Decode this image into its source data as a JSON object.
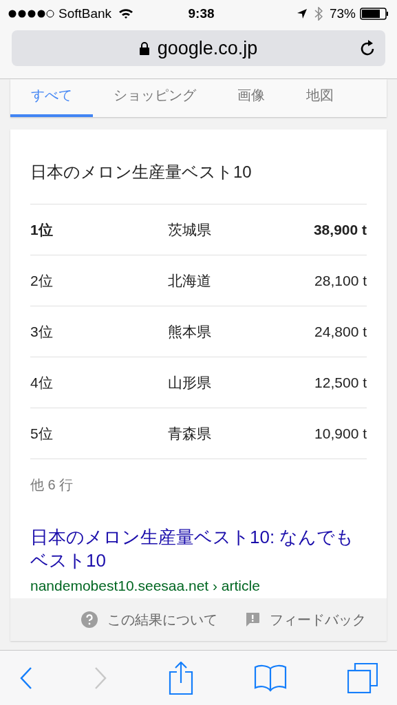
{
  "status_bar": {
    "carrier": "SoftBank",
    "time": "9:38",
    "battery": "73%"
  },
  "address_bar": {
    "url": "google.co.jp"
  },
  "tabs": [
    {
      "label": "すべて",
      "selected": true
    },
    {
      "label": "ショッピング",
      "selected": false
    },
    {
      "label": "画像",
      "selected": false
    },
    {
      "label": "地図",
      "selected": false
    }
  ],
  "result_card": {
    "title": "日本のメロン生産量ベスト10",
    "rows": [
      {
        "rank": "1位",
        "prefecture": "茨城県",
        "amount": "38,900 t",
        "bold": true
      },
      {
        "rank": "2位",
        "prefecture": "北海道",
        "amount": "28,100 t",
        "bold": false
      },
      {
        "rank": "3位",
        "prefecture": "熊本県",
        "amount": "24,800 t",
        "bold": false
      },
      {
        "rank": "4位",
        "prefecture": "山形県",
        "amount": "12,500 t",
        "bold": false
      },
      {
        "rank": "5位",
        "prefecture": "青森県",
        "amount": "10,900 t",
        "bold": false
      }
    ],
    "more_rows": "他 6 行",
    "link_title": "日本のメロン生産量ベスト10: なんでもベスト10",
    "link_url": "nandemobest10.seesaa.net › article",
    "footer": {
      "about": "この結果について",
      "feedback": "フィードバック"
    }
  },
  "toolbar": {
    "back_disabled": false,
    "forward_disabled": true
  }
}
